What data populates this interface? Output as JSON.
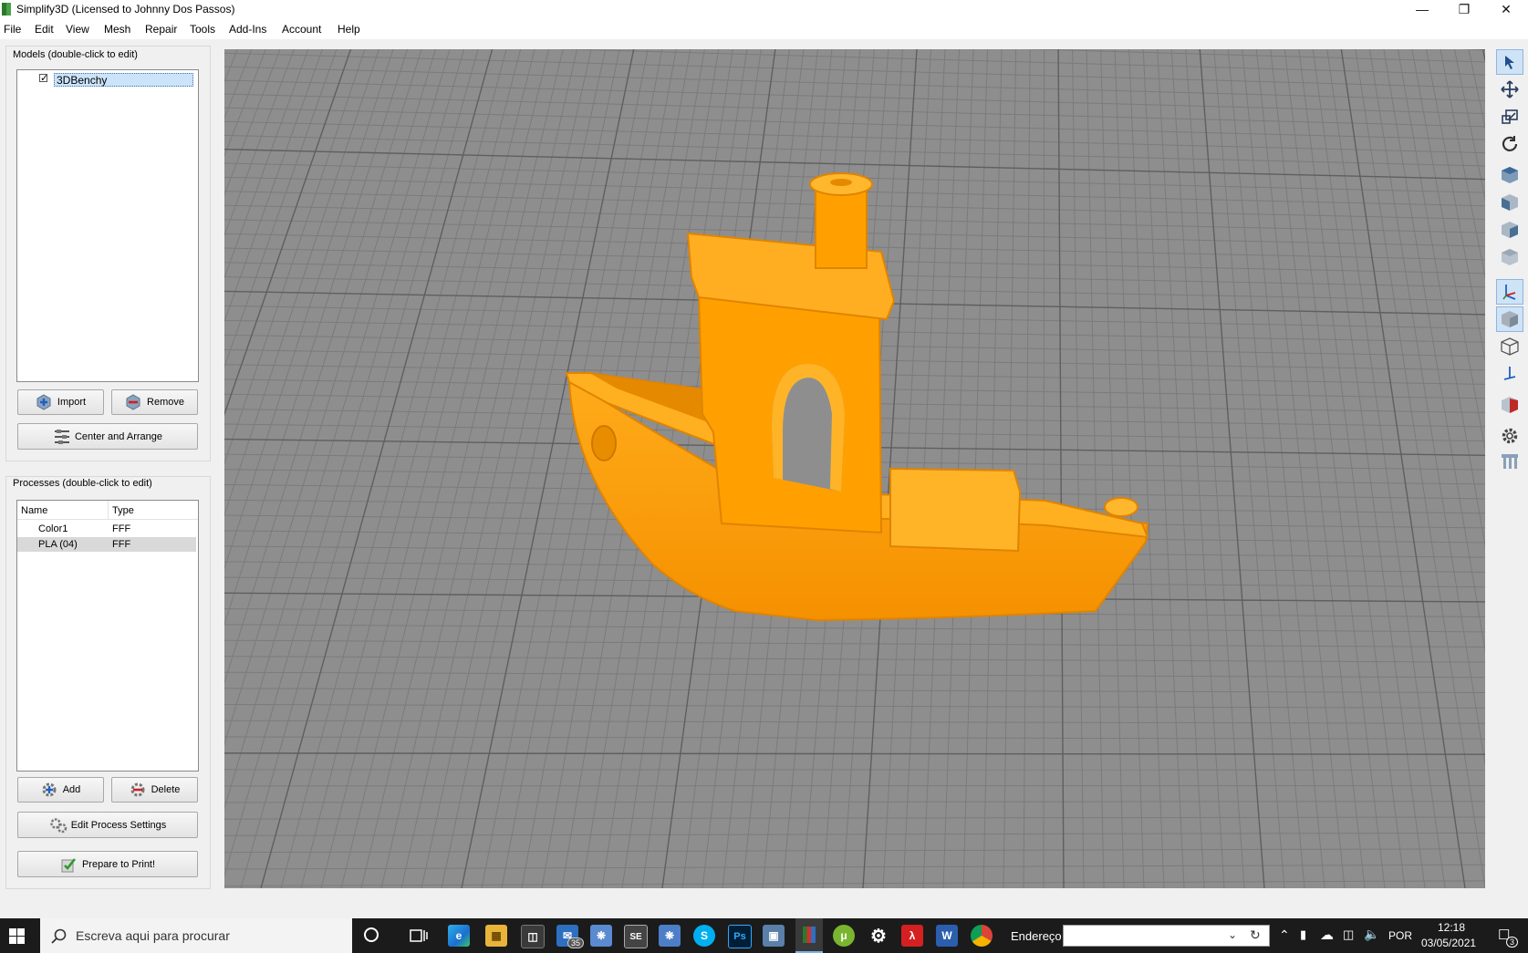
{
  "window": {
    "title": "Simplify3D (Licensed to Johnny Dos Passos)"
  },
  "menu": [
    "File",
    "Edit",
    "View",
    "Mesh",
    "Repair",
    "Tools",
    "Add-Ins",
    "Account",
    "Help"
  ],
  "models": {
    "title": "Models (double-click to edit)",
    "items": [
      {
        "label": "3DBenchy",
        "checked": true
      }
    ],
    "import_label": "Import",
    "remove_label": "Remove",
    "center_label": "Center and Arrange"
  },
  "processes": {
    "title": "Processes (double-click to edit)",
    "columns": [
      "Name",
      "Type"
    ],
    "rows": [
      {
        "name": "Color1",
        "type": "FFF"
      },
      {
        "name": "PLA (04)",
        "type": "FFF"
      }
    ],
    "add_label": "Add",
    "delete_label": "Delete",
    "edit_label": "Edit Process Settings",
    "prepare_label": "Prepare to Print!"
  },
  "viewport": {
    "model_color": "#ffa000",
    "bed_color": "#8e8e8e"
  },
  "taskbar": {
    "search_placeholder": "Escreva aqui para procurar",
    "mail_badge": "35",
    "address_label": "Endereço",
    "language": "POR",
    "time": "12:18",
    "date": "03/05/2021",
    "notification_count": "3"
  }
}
